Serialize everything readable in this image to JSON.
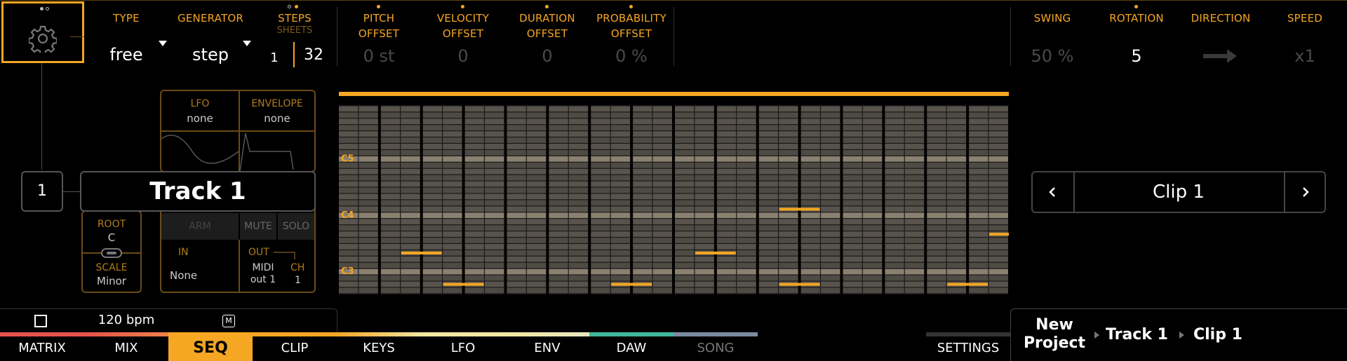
{
  "header": {
    "type": {
      "label": "TYPE",
      "value": "free"
    },
    "generator": {
      "label": "GENERATOR",
      "value": "step"
    },
    "steps": {
      "label": "STEPS",
      "sub_label": "SHEETS",
      "sheets_value": "1",
      "steps_value": "32"
    },
    "pitch_offset": {
      "label1": "PITCH",
      "label2": "OFFSET",
      "value": "0 st"
    },
    "velocity_offset": {
      "label1": "VELOCITY",
      "label2": "OFFSET",
      "value": "0"
    },
    "duration_offset": {
      "label1": "DURATION",
      "label2": "OFFSET",
      "value": "0"
    },
    "probability_offset": {
      "label1": "PROBABILITY",
      "label2": "OFFSET",
      "value": "0 %"
    },
    "swing": {
      "label": "SWING",
      "value": "50 %"
    },
    "rotation": {
      "label": "ROTATION",
      "value": "5"
    },
    "direction": {
      "label": "DIRECTION",
      "icon": "arrow-right-icon"
    },
    "speed": {
      "label": "SPEED",
      "value": "x1"
    }
  },
  "track": {
    "number": "1",
    "name": "Track 1",
    "lfo": {
      "label": "LFO",
      "value": "none"
    },
    "envelope": {
      "label": "ENVELOPE",
      "value": "none"
    },
    "root": {
      "label": "ROOT",
      "value": "C"
    },
    "scale": {
      "label": "SCALE",
      "value": "Minor"
    },
    "arm_label": "ARM",
    "mute_label": "MUTE",
    "solo_label": "SOLO",
    "in": {
      "label": "IN",
      "value": "None"
    },
    "out": {
      "label": "OUT",
      "value_line1": "MIDI",
      "value_line2": "out 1"
    },
    "ch": {
      "label": "CH",
      "value": "1"
    }
  },
  "piano_roll": {
    "note_labels": [
      "C5",
      "C4",
      "C3"
    ],
    "accent_color": "#f5a623",
    "notes": [
      {
        "step": 3,
        "row": 23
      },
      {
        "step": 5,
        "row": 28
      },
      {
        "step": 13,
        "row": 28
      },
      {
        "step": 17,
        "row": 23
      },
      {
        "step": 21,
        "row": 16
      },
      {
        "step": 21,
        "row": 28
      },
      {
        "step": 29,
        "row": 28
      },
      {
        "step": 31,
        "row": 20
      }
    ]
  },
  "clip": {
    "name": "Clip 1",
    "prev_icon": "chevron-left-icon",
    "next_icon": "chevron-right-icon"
  },
  "transport": {
    "bpm": "120 bpm",
    "metronome_label": "M"
  },
  "tabs": [
    {
      "label": "MATRIX",
      "color": "#e8504a"
    },
    {
      "label": "MIX",
      "color": "#f0724a"
    },
    {
      "label": "SEQ",
      "color": "#f5a623",
      "active": true
    },
    {
      "label": "CLIP",
      "color": "#f5a623"
    },
    {
      "label": "KEYS",
      "color": "#f5b03a"
    },
    {
      "label": "LFO",
      "color": "#f2e6a0"
    },
    {
      "label": "ENV",
      "color": "#e8e6b0"
    },
    {
      "label": "DAW",
      "color": "#3fb89a"
    },
    {
      "label": "SONG",
      "color": "#7a8aa0"
    }
  ],
  "settings_label": "SETTINGS",
  "breadcrumb": {
    "project_line1": "New",
    "project_line2": "Project",
    "track": "Track 1",
    "clip": "Clip 1"
  }
}
